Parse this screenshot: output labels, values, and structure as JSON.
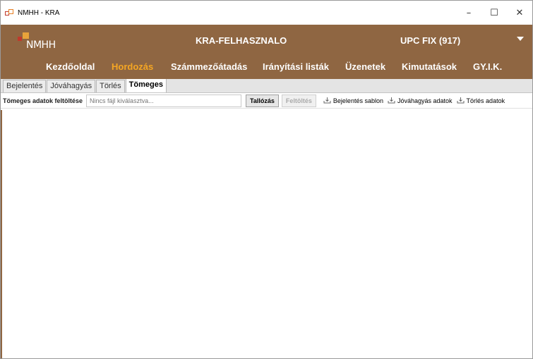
{
  "window": {
    "title": "NMHH - KRA",
    "controls": {
      "minimize": "–",
      "maximize": "☐",
      "close": "✕"
    }
  },
  "header": {
    "logo_text": "NMHH",
    "user": "KRA-FELHASZNALO",
    "provider": "UPC FIX (917)"
  },
  "nav": {
    "items": [
      {
        "label": "Kezdőoldal",
        "active": false
      },
      {
        "label": "Hordozás",
        "active": true
      },
      {
        "label": "Számmezőátadás",
        "active": false
      },
      {
        "label": "Irányítási listák",
        "active": false
      },
      {
        "label": "Üzenetek",
        "active": false
      },
      {
        "label": "Kimutatások",
        "active": false
      },
      {
        "label": "GY.I.K.",
        "active": false
      }
    ],
    "active_color": "#f5a623"
  },
  "subtabs": {
    "items": [
      {
        "label": "Bejelentés",
        "active": false
      },
      {
        "label": "Jóváhagyás",
        "active": false
      },
      {
        "label": "Törlés",
        "active": false
      },
      {
        "label": "Tömeges",
        "active": true
      }
    ]
  },
  "toolbar": {
    "label": "Tömeges adatok feltöltése",
    "file_placeholder": "Nincs fájl kiválasztva...",
    "browse_label": "Tallózás",
    "upload_label": "Feltöltés",
    "links": [
      {
        "label": "Bejelentés sablon",
        "icon": "download-tray-icon"
      },
      {
        "label": "Jóváhagyás adatok",
        "icon": "download-tray-icon"
      },
      {
        "label": "Törlés adatok",
        "icon": "download-tray-icon"
      }
    ]
  },
  "theme": {
    "brand": "#8f6642"
  }
}
